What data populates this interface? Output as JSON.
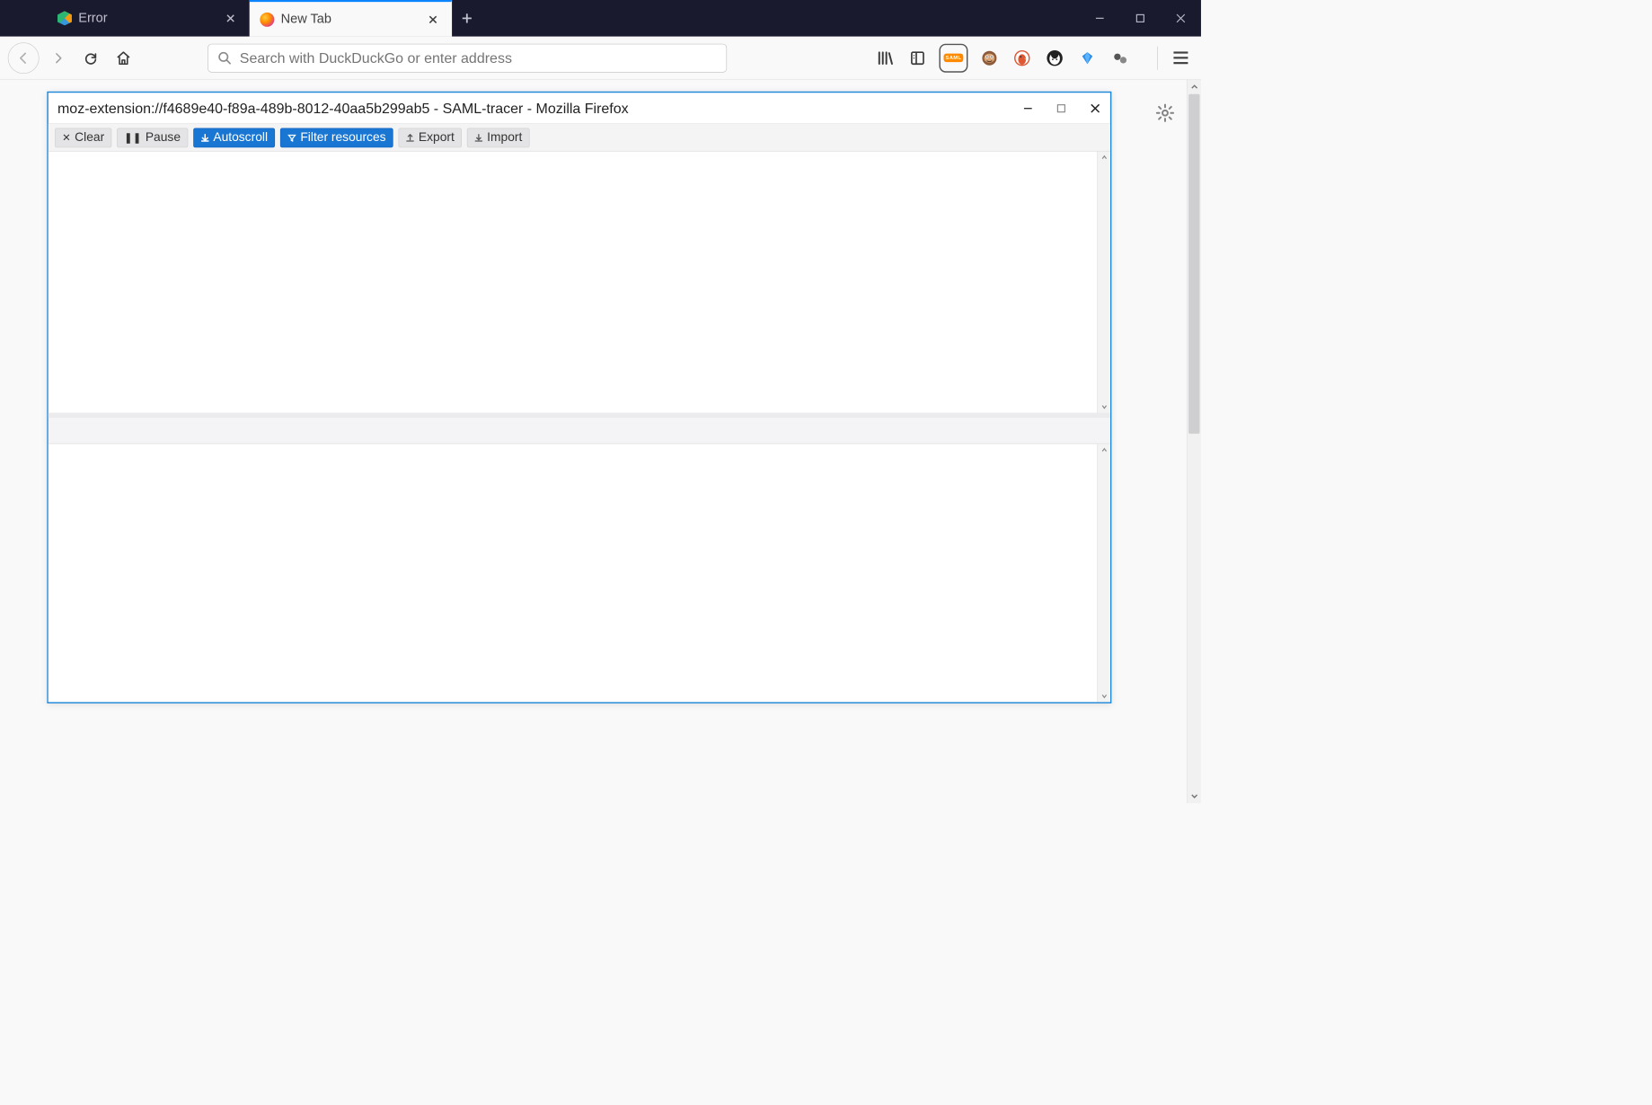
{
  "tabs": [
    {
      "title": "Error",
      "active": false
    },
    {
      "title": "New Tab",
      "active": true
    }
  ],
  "urlbar": {
    "placeholder": "Search with DuckDuckGo or enter address"
  },
  "ext_icons": {
    "library": "library-icon",
    "reader": "reader-icon",
    "saml": "SAML",
    "monkey": "tampermonkey-icon",
    "ddg": "duckduckgo-icon",
    "privacy": "privacy-badger-icon",
    "sapphire": "sapphire-icon",
    "other": "greasemonkey-icon"
  },
  "popup": {
    "title": "moz-extension://f4689e40-f89a-489b-8012-40aa5b299ab5 - SAML-tracer - Mozilla Firefox",
    "toolbar": {
      "clear": "Clear",
      "pause": "Pause",
      "autoscroll": "Autoscroll",
      "filter": "Filter resources",
      "export": "Export",
      "import": "Import"
    }
  }
}
